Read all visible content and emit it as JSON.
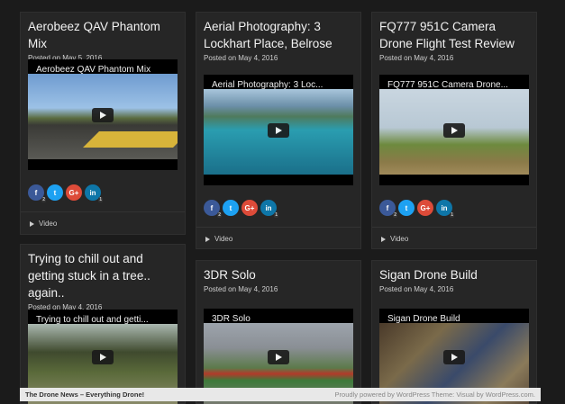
{
  "posts": [
    {
      "title": "Aerobeez QAV Phantom Mix",
      "date": "Posted on May 5, 2016",
      "video_title": "Aerobeez QAV Phantom Mix",
      "share_counts": [
        "2",
        "",
        "",
        "1"
      ],
      "footer_label": "Video"
    },
    {
      "title": "Aerial Photography: 3 Lockhart Place, Belrose",
      "date": "Posted on May 4, 2016",
      "video_title": "Aerial Photography: 3 Loc...",
      "share_counts": [
        "2",
        "",
        "",
        "1"
      ],
      "footer_label": "Video"
    },
    {
      "title": "FQ777 951C Camera Drone Flight Test Review",
      "date": "Posted on May 4, 2016",
      "video_title": "FQ777 951C Camera Drone...",
      "share_counts": [
        "2",
        "",
        "",
        "1"
      ],
      "footer_label": "Video"
    },
    {
      "title": "Trying to chill out and getting stuck in a tree.. again..",
      "date": "Posted on May 4, 2016",
      "video_title": "Trying to chill out and getti..."
    },
    {
      "title": "3DR Solo",
      "date": "Posted on May 4, 2016",
      "video_title": "3DR Solo"
    },
    {
      "title": "Sigan Drone Build",
      "date": "Posted on May 4, 2016",
      "video_title": "Sigan Drone Build"
    }
  ],
  "share_icons": {
    "facebook": "f",
    "twitter": "t",
    "google": "G+",
    "linkedin": "in"
  },
  "footer": {
    "site_name": "The Drone News – Everything Drone!",
    "credit": "Proudly powered by WordPress Theme: Visual by WordPress.com."
  }
}
